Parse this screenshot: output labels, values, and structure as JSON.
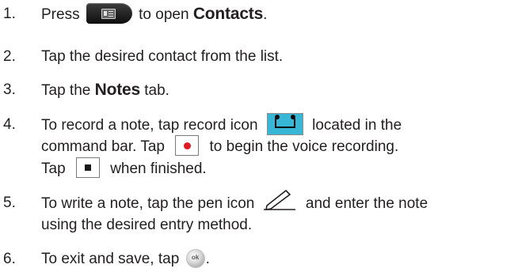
{
  "steps": [
    {
      "number": "1.",
      "lines": [
        {
          "pre": "Press",
          "post": "to open",
          "bold": "Contacts",
          "end": "."
        }
      ]
    },
    {
      "number": "2.",
      "lines": [
        {
          "text": "Tap the desired contact from the list."
        }
      ]
    },
    {
      "number": "3.",
      "lines": [
        {
          "pre": "Tap the",
          "bold": "Notes",
          "post": "tab."
        }
      ]
    },
    {
      "number": "4.",
      "lines": [
        {
          "pre": "To record a note, tap record icon",
          "post": "located in the"
        },
        {
          "pre": "command bar. Tap",
          "post": "to begin the voice recording."
        },
        {
          "pre": "Tap",
          "post": "when finished."
        }
      ]
    },
    {
      "number": "5.",
      "lines": [
        {
          "pre": "To write a note, tap the pen icon",
          "post": "and enter the note"
        },
        {
          "text": "using the desired entry method."
        }
      ]
    },
    {
      "number": "6.",
      "lines": [
        {
          "pre": "To exit and save, tap",
          "post": "."
        }
      ]
    }
  ],
  "icons": {
    "contacts_key": "contacts-key-icon",
    "record": "record-tape-icon",
    "record_start": "record-dot-icon",
    "stop": "stop-square-icon",
    "pen": "pen-icon",
    "ok": "ok-button-icon",
    "ok_label": "ok"
  },
  "colors": {
    "text": "#231f20",
    "record_icon_bg": "#38b6d6",
    "record_dot": "#e01b22"
  }
}
